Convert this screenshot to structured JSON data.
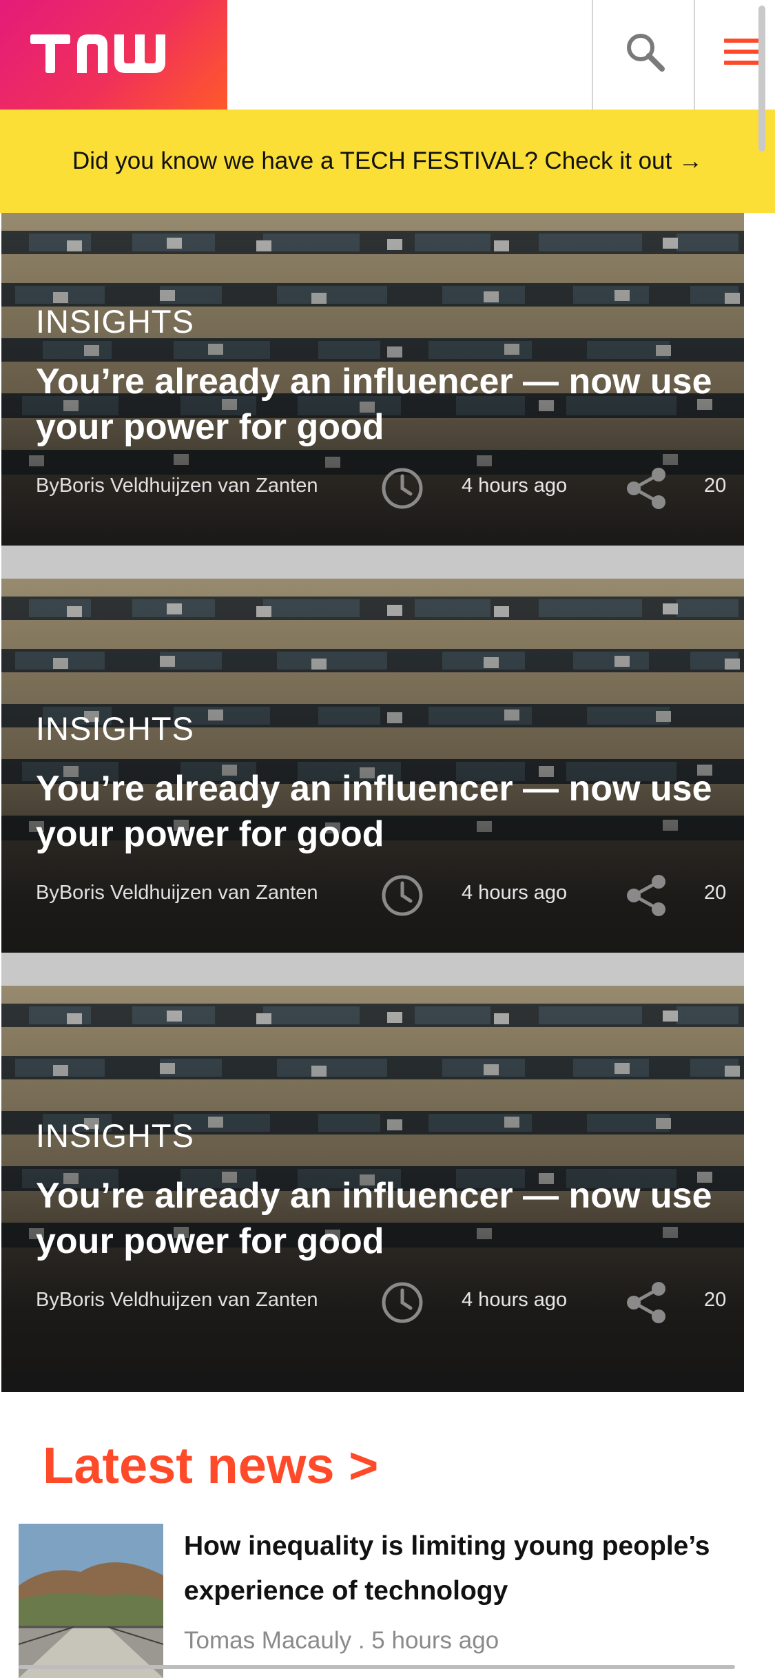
{
  "header": {
    "logo_text": "TNW",
    "search_icon": "search-icon",
    "menu_icon": "hamburger-menu-icon",
    "brand_gradient": [
      "#e51b7a",
      "#ff5a2a"
    ],
    "accent_color": "#ff4a2a"
  },
  "promo": {
    "text": "Did you know we have a TECH FESTIVAL? Check it out →",
    "background": "#fbde36"
  },
  "featured": [
    {
      "category": "INSIGHTS",
      "title": "You’re already an influencer — now use your power for good",
      "author": "ByBoris Veldhuijzen van Zanten",
      "time": "4 hours ago",
      "shares": "20"
    },
    {
      "category": "INSIGHTS",
      "title": "You’re already an influencer — now use your power for good",
      "author": "ByBoris Veldhuijzen van Zanten",
      "time": "4 hours ago",
      "shares": "20"
    },
    {
      "category": "INSIGHTS",
      "title": "You’re already an influencer — now use your power for good",
      "author": "ByBoris Veldhuijzen van Zanten",
      "time": "4 hours ago",
      "shares": "20"
    }
  ],
  "latest": {
    "heading": "Latest news >",
    "items": [
      {
        "title": "How inequality is limiting young people’s experience of technology",
        "meta": "Tomas Macauly . 5 hours ago"
      }
    ]
  }
}
